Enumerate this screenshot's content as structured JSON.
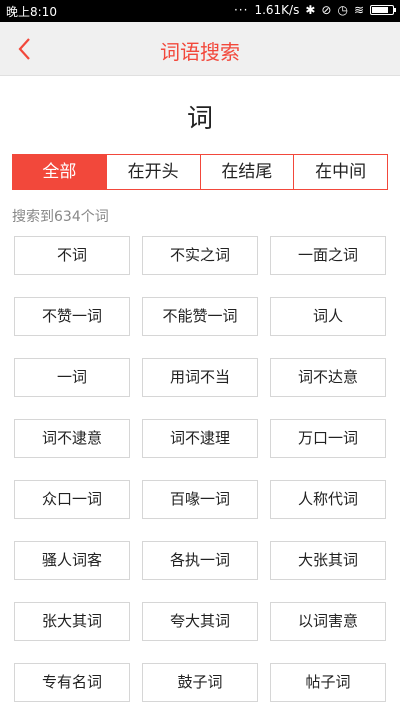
{
  "status_bar": {
    "time": "晚上8:10",
    "network_speed": "1.61K/s",
    "battery_level": 0.8
  },
  "header": {
    "title": "词语搜索",
    "back_icon": "chevron-left-icon"
  },
  "search": {
    "keyword": "词",
    "tabs": [
      {
        "label": "全部",
        "active": true
      },
      {
        "label": "在开头",
        "active": false
      },
      {
        "label": "在结尾",
        "active": false
      },
      {
        "label": "在中间",
        "active": false
      }
    ],
    "result_count_text": "搜索到634个词"
  },
  "results": [
    "不词",
    "不实之词",
    "一面之词",
    "不赞一词",
    "不能赞一词",
    "词人",
    "一词",
    "用词不当",
    "词不达意",
    "词不逮意",
    "词不逮理",
    "万口一词",
    "众口一词",
    "百喙一词",
    "人称代词",
    "骚人词客",
    "各执一词",
    "大张其词",
    "张大其词",
    "夸大其词",
    "以词害意",
    "专有名词",
    "鼓子词",
    "帖子词"
  ],
  "colors": {
    "accent": "#f2483b",
    "header_bg": "#f0f0f0",
    "status_bar_bg": "#000000"
  }
}
